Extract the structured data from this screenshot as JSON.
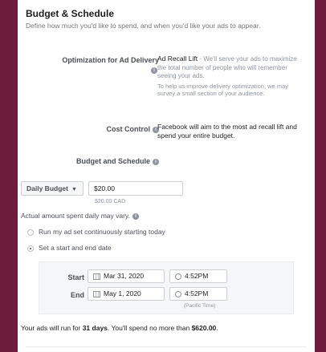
{
  "section": {
    "title": "Budget & Schedule",
    "subtitle": "Define how much you'd like to spend, and when you'd like your ads to appear."
  },
  "optimization": {
    "label": "Optimization for Ad Delivery",
    "value_strong": "Ad Recall Lift",
    "value_rest": " - We'll serve your ads to maximize the total number of people who will remember seeing your ads.",
    "note": "To help us improve delivery optimization, we may survey a small section of your audience."
  },
  "cost_control": {
    "label": "Cost Control",
    "text": "Facebook will aim to the most ad recall lift and spend your entire budget."
  },
  "budget_schedule": {
    "label": "Budget and Schedule",
    "budget_type": "Daily Budget",
    "amount": "$20.00",
    "amount_caption": "$20.00 CAD",
    "note": "Actual amount spent daily may vary.",
    "option_continuous": "Run my ad set continuously starting today",
    "option_start_end": "Set a start and end date"
  },
  "schedule": {
    "start_label": "Start",
    "start_date": "Mar 31, 2020",
    "start_time": "4:52PM",
    "end_label": "End",
    "end_date": "May 1, 2020",
    "end_time": "4:52PM",
    "timezone": "(Pacific Time)"
  },
  "summary": {
    "prefix": "Your ads will run for ",
    "days": "31 days",
    "middle": ". You'll spend no more than ",
    "amount": "$620.00",
    "suffix": "."
  }
}
